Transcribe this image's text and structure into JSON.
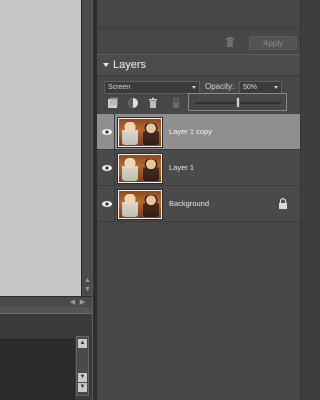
{
  "top_section": {
    "apply_label": "Apply",
    "trash_icon": "trash-icon"
  },
  "layers_panel": {
    "title": "Layers",
    "blend_mode": "Screen",
    "opacity_label": "Opacity:",
    "opacity_value": "50%",
    "opacity_slider_fraction": 0.5,
    "tools": [
      "new-layer-icon",
      "adjustment-layer-icon",
      "delete-layer-icon",
      "lock-transparency-icon"
    ],
    "layers": [
      {
        "name": "Layer 1 copy",
        "visible": true,
        "selected": true,
        "locked": false
      },
      {
        "name": "Layer 1",
        "visible": true,
        "selected": false,
        "locked": false
      },
      {
        "name": "Background",
        "visible": true,
        "selected": false,
        "locked": true
      }
    ]
  },
  "colors": {
    "panel_bg": "#474747",
    "selected_row": "#8f8f8f",
    "canvas_bg": "#c5c5c5"
  }
}
